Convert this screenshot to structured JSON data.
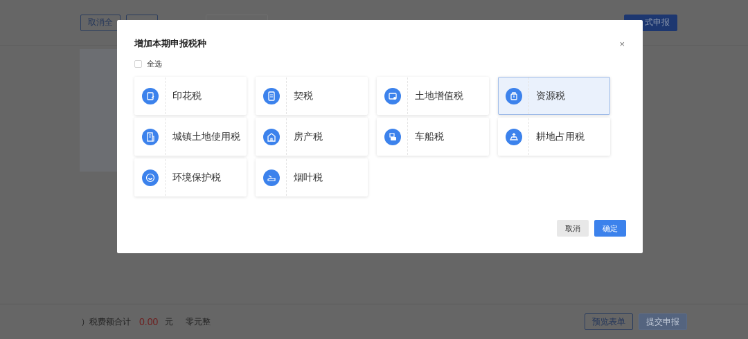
{
  "page": {
    "toolbar": {
      "deselect_all_button": "取消全",
      "declare_button": "式申报"
    },
    "footer": {
      "total_label": "）税费额合计",
      "amount": "0.00",
      "unit": "元",
      "amount_in_words": "零元整",
      "buttons": [
        {
          "label": "预览表单",
          "disabled": false
        },
        {
          "label": "提交申报",
          "disabled": true
        }
      ]
    }
  },
  "dialog": {
    "title": "增加本期申报税种",
    "close": "×",
    "select_all": {
      "label": "全选",
      "checked": false
    },
    "taxes": [
      {
        "name": "印花税",
        "selected": false
      },
      {
        "name": "契税",
        "selected": false
      },
      {
        "name": "土地增值税",
        "selected": false
      },
      {
        "name": "资源税",
        "selected": true
      },
      {
        "name": "城镇土地使用税",
        "selected": false
      },
      {
        "name": "房产税",
        "selected": false
      },
      {
        "name": "车船税",
        "selected": false
      },
      {
        "name": "耕地占用税",
        "selected": false
      },
      {
        "name": "环境保护税",
        "selected": false
      },
      {
        "name": "烟叶税",
        "selected": false
      }
    ],
    "buttons": [
      {
        "label": "取消",
        "kind": "secondary"
      },
      {
        "label": "确定",
        "kind": "primary"
      }
    ]
  }
}
